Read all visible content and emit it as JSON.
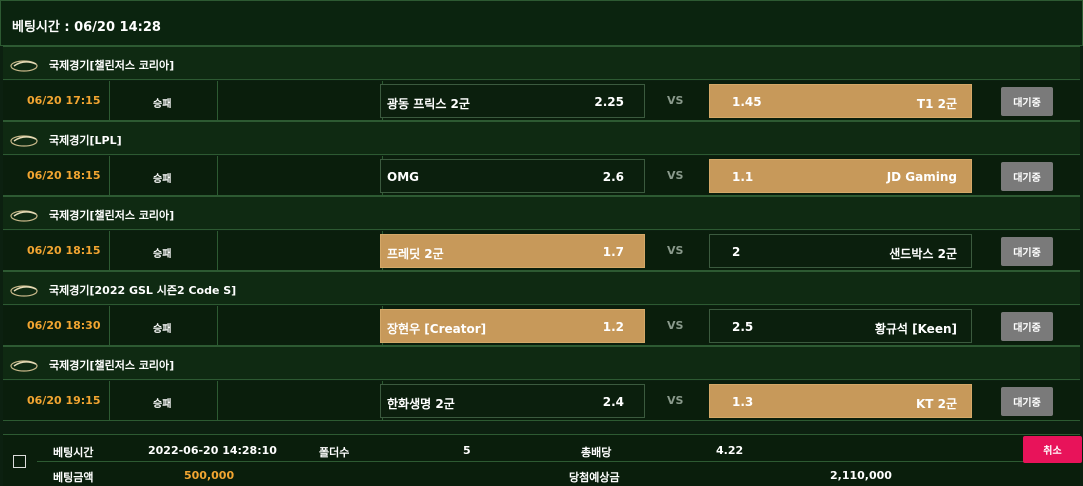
{
  "header": {
    "bet_time_label": "베팅시간 : 06/20 14:28"
  },
  "colors": {
    "accent_orange": "#f2a531",
    "selected_pick": "#c7995a",
    "cancel": "#e8135a",
    "waiting": "#7a7a7a"
  },
  "matches": [
    {
      "league": "국제경기[챌린저스 코리아]",
      "time": "06/20 17:15",
      "bet_type": "승패",
      "home_team": "광동 프릭스 2군",
      "home_odds": "2.25",
      "vs": "VS",
      "away_odds": "1.45",
      "away_team": "T1 2군",
      "selected": "away",
      "status": "대기중"
    },
    {
      "league": "국제경기[LPL]",
      "time": "06/20 18:15",
      "bet_type": "승패",
      "home_team": "OMG",
      "home_odds": "2.6",
      "vs": "VS",
      "away_odds": "1.1",
      "away_team": "JD Gaming",
      "selected": "away",
      "status": "대기중"
    },
    {
      "league": "국제경기[챌린저스 코리아]",
      "time": "06/20 18:15",
      "bet_type": "승패",
      "home_team": "프레딧 2군",
      "home_odds": "1.7",
      "vs": "VS",
      "away_odds": "2",
      "away_team": "샌드박스 2군",
      "selected": "home",
      "status": "대기중"
    },
    {
      "league": "국제경기[2022 GSL 시즌2 Code S]",
      "time": "06/20 18:30",
      "bet_type": "승패",
      "home_team": "장현우 [Creator]",
      "home_odds": "1.2",
      "vs": "VS",
      "away_odds": "2.5",
      "away_team": "황규석 [Keen]",
      "selected": "home",
      "status": "대기중"
    },
    {
      "league": "국제경기[챌린저스 코리아]",
      "time": "06/20 19:15",
      "bet_type": "승패",
      "home_team": "한화생명 2군",
      "home_odds": "2.4",
      "vs": "VS",
      "away_odds": "1.3",
      "away_team": "KT 2군",
      "selected": "away",
      "status": "대기중"
    }
  ],
  "summary": {
    "bet_time_label": "베팅시간",
    "bet_time_value": "2022-06-20 14:28:10",
    "folder_label": "폴더수",
    "folder_value": "5",
    "total_odds_label": "총배당",
    "total_odds_value": "4.22",
    "bet_amount_label": "베팅금액",
    "bet_amount_value": "500,000",
    "expected_win_label": "당첨예상금",
    "expected_win_value": "2,110,000",
    "cancel_label": "취소"
  }
}
